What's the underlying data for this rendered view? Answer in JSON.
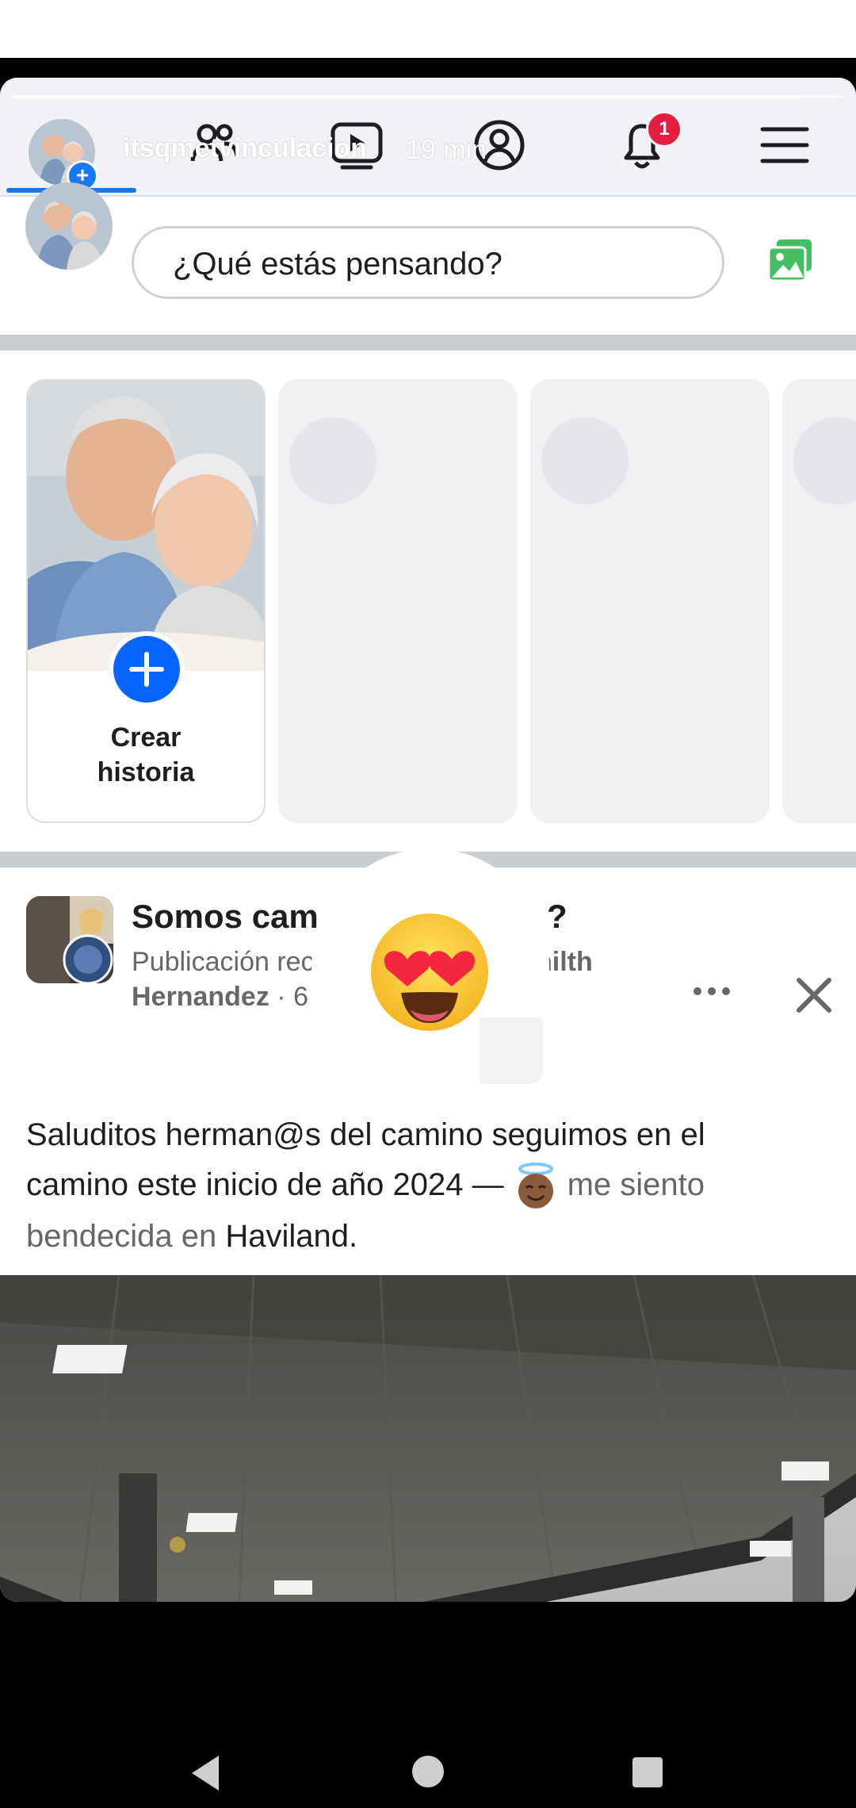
{
  "story": {
    "username": "itsqmetvinculacion",
    "time_ago": "19 min",
    "progress": 0.95
  },
  "header": {
    "notification_count": "1",
    "icons": [
      "friends-icon",
      "video-icon",
      "profile-icon",
      "bell-icon",
      "menu-icon"
    ],
    "accent_color": "#1877f2"
  },
  "composer": {
    "placeholder": "¿Qué estás pensando?",
    "photo_icon": "photo-icon"
  },
  "stories": {
    "create_label_line1": "Crear",
    "create_label_line2": "historia"
  },
  "post": {
    "title_visible": "Somos cam",
    "title_end": "?",
    "subtitle_visible": "Publicación rec",
    "subtitle_end": "hilth",
    "author": "Hernandez",
    "age": "6 d",
    "text_line1": "Saluditos herman@s del camino seguimos en el",
    "text_line2_part1": "camino este inicio de año 2024 —",
    "feeling": "me siento",
    "feeling_line2": "bendecida en",
    "location": "Haviland",
    "end_punct": "."
  },
  "reaction": {
    "emoji_name": "heart-eyes-emoji"
  }
}
